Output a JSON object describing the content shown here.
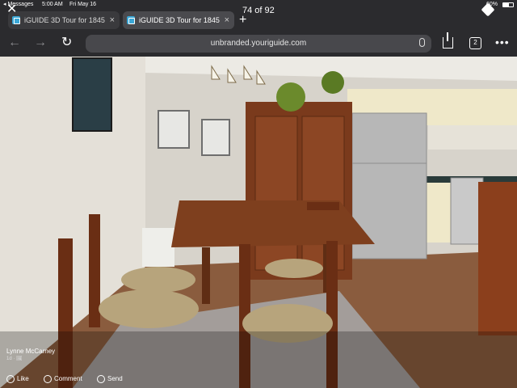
{
  "status_bar": {
    "back_app": "◂ Messages",
    "time": "5:00 AM",
    "date": "Fri May 16",
    "battery": "60%",
    "battery_level": 0.6
  },
  "overlay": {
    "close_symbol": "✕",
    "photo_counter": "74 of 92"
  },
  "tabs": [
    {
      "label": "iGUIDE 3D Tour for 1845",
      "active": false
    },
    {
      "label": "iGUIDE 3D Tour for 1845",
      "active": true
    }
  ],
  "toolbar": {
    "url": "unbranded.youriguide.com",
    "tab_count": "2",
    "back_icon": "←",
    "forward_icon": "→",
    "reload_icon": "↻",
    "more_icon": "•••",
    "new_tab_icon": "+"
  },
  "post": {
    "author": "Lynne McCarney",
    "author_meta": "1d · 🖼",
    "actions": {
      "like": "Like",
      "comment": "Comment",
      "send": "Send"
    }
  }
}
